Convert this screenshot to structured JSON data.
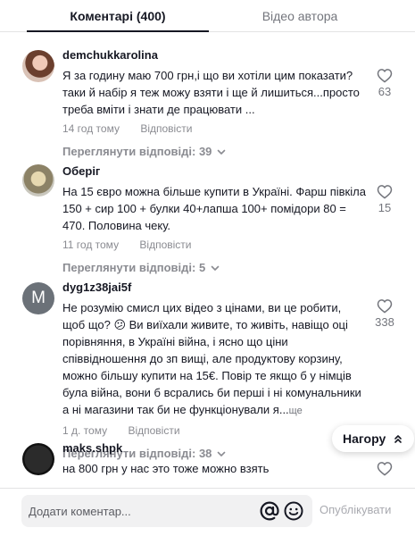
{
  "tabs": [
    {
      "label": "Коментарі (400)"
    },
    {
      "label": "Відео автора"
    }
  ],
  "comments": [
    {
      "author": "demchukkarolina",
      "text": "Я за годину маю 700 грн,і що ви хотіли цим показати?таки й набір я теж можу взяти і ще й лишиться...просто треба вміти і знати де працювати ...",
      "time": "14 год тому",
      "reply_label": "Відповісти",
      "view_replies": "Переглянути відповіді: 39",
      "likes": "63"
    },
    {
      "author": "Оберіг",
      "text": "На 15 євро можна більше купити в Україні. Фарш півкіла 150 + сир 100 + булки 40+лапша 100+ помідори 80 = 470. Половина чеку.",
      "time": "11 год тому",
      "reply_label": "Відповісти",
      "view_replies": "Переглянути відповіді: 5",
      "likes": "15"
    },
    {
      "author": "dyg1z38jai5f",
      "avatar_letter": "M",
      "text": "Не розумію смисл цих відео з цінами, ви це робити, щоб що? 😕 Ви виїхали живите, то живіть, навіщо оці порівняння, в Україні війна, і ясно що ціни співвідношення до зп вищі, але продуктову корзину, можно більшу купити на 15€. Повір те якщо б у німців була війна, вони б всрались би перші і ні комунальники а ні магазини так би не функціонували я...",
      "more_label": "ще",
      "time": "1 д. тому",
      "reply_label": "Відповісти",
      "view_replies": "Переглянути відповіді: 38",
      "likes": "338"
    },
    {
      "author": "maks.shpk",
      "text": "на 800 грн у нас это тоже можно взять"
    }
  ],
  "to_top": {
    "label": "Нагору"
  },
  "footer": {
    "placeholder": "Додати коментар...",
    "post_label": "Опублікувати"
  },
  "colors": {
    "text": "#161823",
    "secondary": "#8a8b91",
    "input_bg": "#f1f1f2",
    "post_disabled": "#a9aab0"
  },
  "icons": [
    "heart-icon",
    "chevron-down-icon",
    "double-chevron-up-icon",
    "at-icon",
    "emoji-icon"
  ]
}
